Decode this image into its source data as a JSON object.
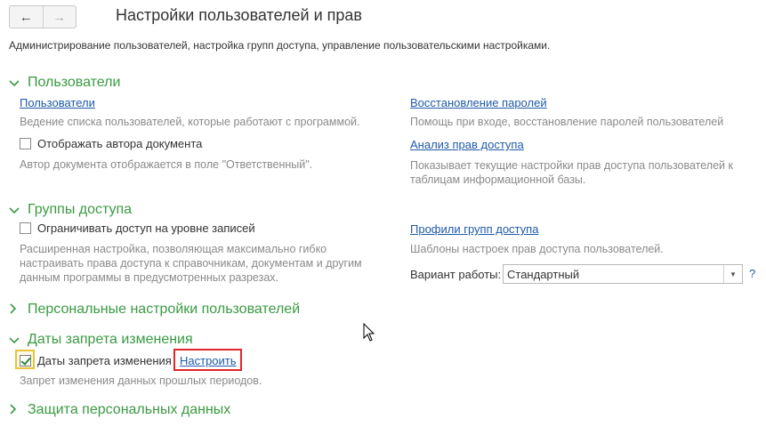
{
  "nav": {
    "back_icon": "←",
    "forward_icon": "→"
  },
  "header": {
    "title": "Настройки пользователей и прав",
    "subtitle": "Администрирование пользователей, настройка групп доступа, управление пользовательскими настройками."
  },
  "sections": {
    "users": {
      "title": "Пользователи",
      "users_link": "Пользователи",
      "users_desc": "Ведение списка пользователей, которые работают с программой.",
      "show_author_label": "Отображать автора документа",
      "show_author_checked": false,
      "show_author_desc": "Автор документа отображается в поле \"Ответственный\".",
      "password_recovery_link": "Восстановление паролей",
      "password_recovery_desc": "Помощь при входе, восстановление паролей пользователей",
      "access_analysis_link": "Анализ прав доступа",
      "access_analysis_desc_1": "Показывает текущие настройки прав доступа пользователей к",
      "access_analysis_desc_2": "таблицам информационной базы."
    },
    "access_groups": {
      "title": "Группы доступа",
      "restrict_label": "Ограничивать доступ на уровне записей",
      "restrict_checked": false,
      "restrict_desc_1": "Расширенная настройка, позволяющая максимально гибко",
      "restrict_desc_2": "настраивать права доступа к справочникам, документам и другим",
      "restrict_desc_3": "данным программы в предусмотренных разрезах.",
      "profiles_link": "Профили групп доступа",
      "profiles_desc": "Шаблоны настроек прав доступа пользователей.",
      "mode_label": "Вариант работы:",
      "mode_value": "Стандартный",
      "help": "?"
    },
    "personal": {
      "title": "Персональные настройки пользователей"
    },
    "closing_dates": {
      "title": "Даты запрета изменения",
      "checkbox_label": "Даты запрета изменения",
      "checked": true,
      "configure_link": "Настроить",
      "desc": "Запрет изменения данных прошлых периодов."
    },
    "personal_data": {
      "title": "Защита персональных данных"
    }
  },
  "colors": {
    "section_green": "#3a9a43",
    "link_blue": "#1f5aa8",
    "highlight_red": "#e0262b"
  }
}
